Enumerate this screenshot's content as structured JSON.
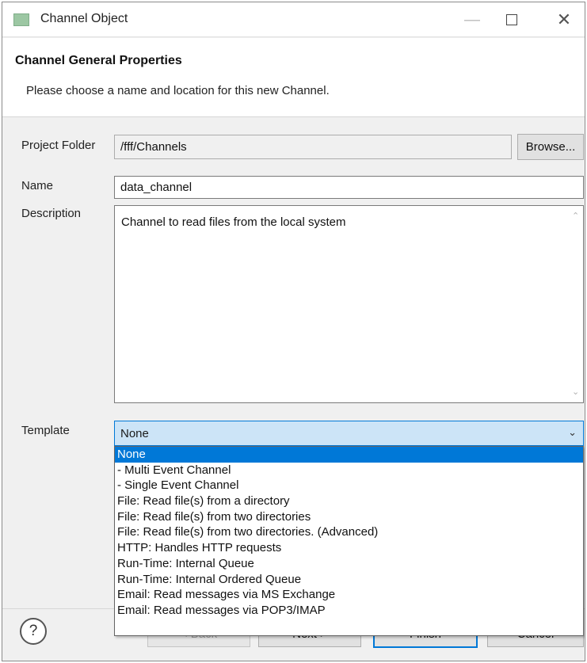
{
  "window": {
    "title": "Channel Object",
    "minimize_glyph": "—",
    "close_glyph": "✕"
  },
  "header": {
    "title": "Channel General Properties",
    "description": "Please choose a name and location for this new Channel."
  },
  "form": {
    "project_folder_label": "Project Folder",
    "project_folder_value": "/fff/Channels",
    "browse_label": "Browse...",
    "name_label": "Name",
    "name_value": "data_channel",
    "description_label": "Description",
    "description_value": "Channel to read files from the local system",
    "template_label": "Template",
    "template_value": "None"
  },
  "template_options": [
    "None",
    "- Multi Event Channel",
    "- Single Event Channel",
    "File: Read file(s) from a directory",
    "File: Read file(s) from two directories",
    "File: Read file(s) from two directories. (Advanced)",
    "HTTP: Handles HTTP requests",
    "Run-Time: Internal Queue",
    "Run-Time: Internal Ordered Queue",
    "Email: Read messages via MS Exchange",
    "Email: Read messages via POP3/IMAP"
  ],
  "selected_template_index": 0,
  "footer": {
    "help_glyph": "?",
    "back_label": "< Back",
    "next_label": "Next >",
    "finish_label": "Finish",
    "cancel_label": "Cancel"
  },
  "colors": {
    "selection": "#0078d7",
    "combo_focus": "#cce4f7"
  },
  "icons": {
    "app": "channel-app-icon",
    "help": "help-icon",
    "dropdown": "chevron-down-icon"
  }
}
